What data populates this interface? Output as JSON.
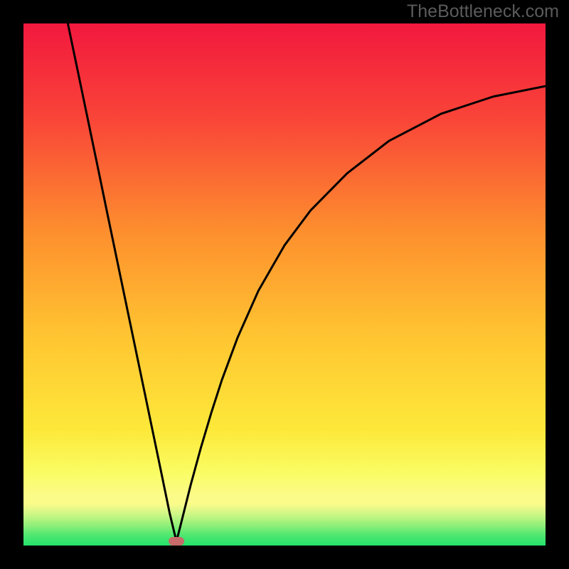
{
  "watermark": {
    "text": "TheBottleneck.com"
  },
  "chart_data": {
    "type": "line",
    "title": "",
    "xlabel": "",
    "ylabel": "",
    "xlim": [
      0,
      100
    ],
    "ylim": [
      0,
      100
    ],
    "grid": false,
    "legend": false,
    "gradient_colors": {
      "top": "#f2183e",
      "mid_upper": "#fd8f2e",
      "mid": "#fde93a",
      "low_band": "#fbfb8a",
      "bottom": "#23e26c"
    },
    "series": [
      {
        "name": "left_branch",
        "x": [
          8.5,
          10,
          12,
          14,
          16,
          18,
          20,
          22,
          24,
          26,
          28,
          29.3
        ],
        "y": [
          100,
          92.8,
          83.2,
          73.6,
          63.9,
          54.3,
          44.7,
          35.1,
          25.5,
          15.9,
          6.2,
          0.8
        ]
      },
      {
        "name": "right_branch",
        "x": [
          29.3,
          30,
          32,
          34,
          36,
          38,
          41,
          45,
          50,
          55,
          62,
          70,
          80,
          90,
          100
        ],
        "y": [
          0.8,
          3.5,
          11.5,
          18.8,
          25.5,
          31.7,
          39.8,
          48.8,
          57.5,
          64.2,
          71.3,
          77.5,
          82.7,
          86.0,
          88.0
        ]
      }
    ],
    "marker": {
      "x": 29.3,
      "y": 0.8,
      "color": "#c76a6a"
    }
  }
}
